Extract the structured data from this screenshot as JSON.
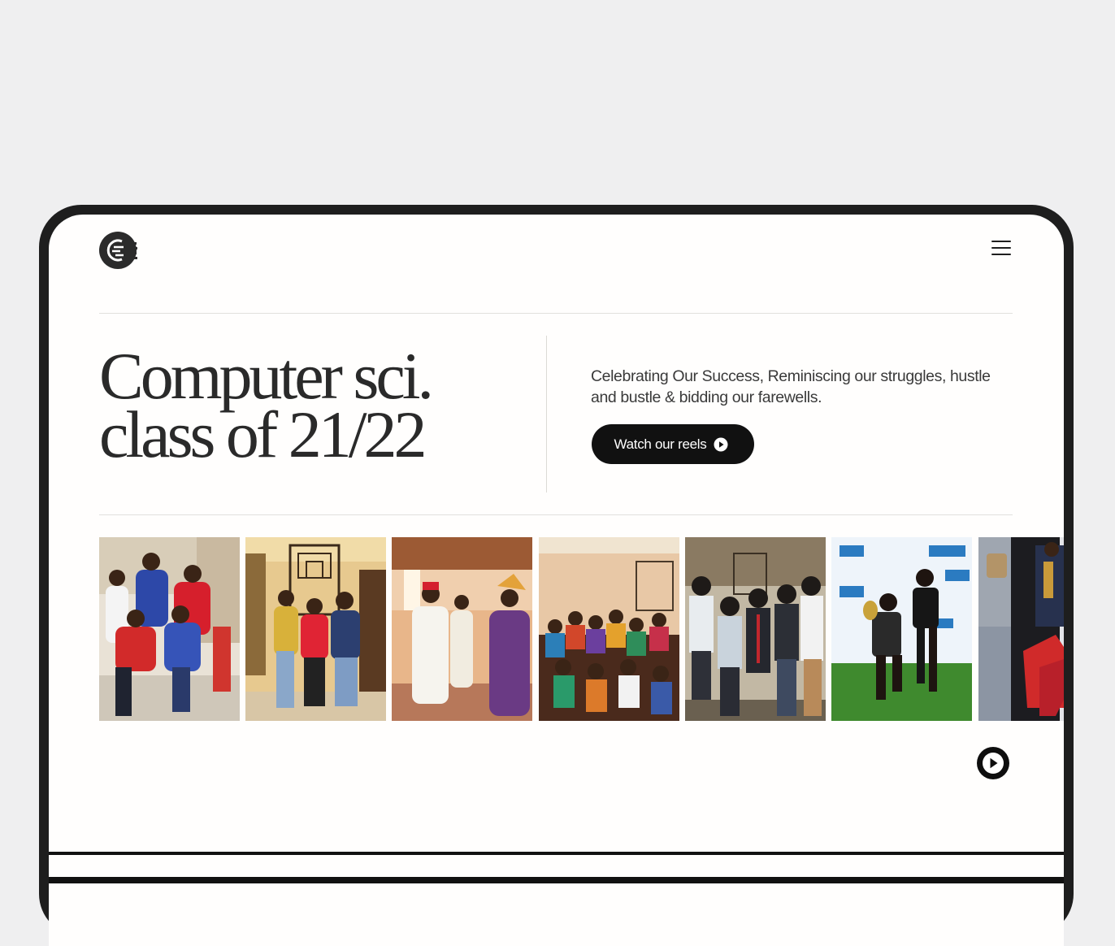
{
  "header": {
    "logo_icon": "cs-class-logo-icon",
    "menu_icon": "hamburger-menu-icon"
  },
  "hero": {
    "title_line1": "Computer sci.",
    "title_line2": "class of 21/22",
    "tagline": "Celebrating Our Success, Reminiscing our struggles, hustle and bustle & bidding our farewells.",
    "cta_label": "Watch our reels",
    "cta_icon": "play-circle-icon"
  },
  "gallery": {
    "photos": [
      {
        "name": "group-jerseys-photo"
      },
      {
        "name": "hallway-friends-photo"
      },
      {
        "name": "traditional-attire-photo"
      },
      {
        "name": "classroom-group-photo"
      },
      {
        "name": "vintage-costume-photo"
      },
      {
        "name": "man-of-the-match-photo"
      },
      {
        "name": "trophy-photo"
      }
    ],
    "play_icon": "play-icon"
  },
  "colors": {
    "page_bg": "#efeff0",
    "device_frame": "#1e1e1e",
    "screen_bg": "#fffefd",
    "text_dark": "#2a2a2a",
    "button_bg": "#111111"
  }
}
